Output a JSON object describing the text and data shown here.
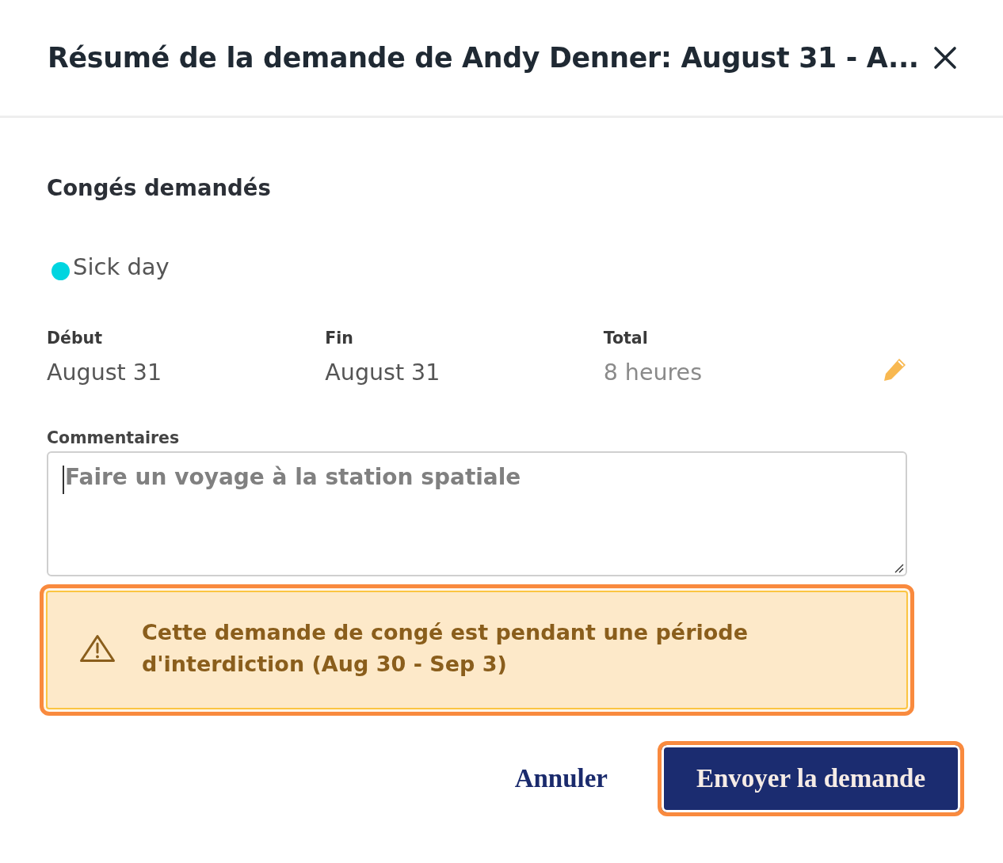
{
  "dialog": {
    "title": "Résumé de la demande de Andy Denner: August 31 - A..."
  },
  "section_title": "Congés demandés",
  "leave_type": {
    "label": "Sick day",
    "color": "#00d5e0"
  },
  "details": [
    {
      "label": "Début",
      "value": "August 31",
      "kind": "text"
    },
    {
      "label": "Fin",
      "value": "August 31",
      "kind": "text"
    },
    {
      "label": "Total",
      "value": "8 heures",
      "kind": "editable"
    }
  ],
  "comments": {
    "label": "Commentaires",
    "placeholder": "Faire un voyage à la station spatiale",
    "focused": true
  },
  "alert": {
    "text": "Cette demande de congé est pendant une période d'interdiction (Aug 30 - Sep 3)",
    "highlighted": true
  },
  "buttons": [
    {
      "label": "Annuler",
      "kind": "link",
      "highlighted": false
    },
    {
      "label": "Envoyer la demande",
      "kind": "primary",
      "highlighted": true
    }
  ]
}
